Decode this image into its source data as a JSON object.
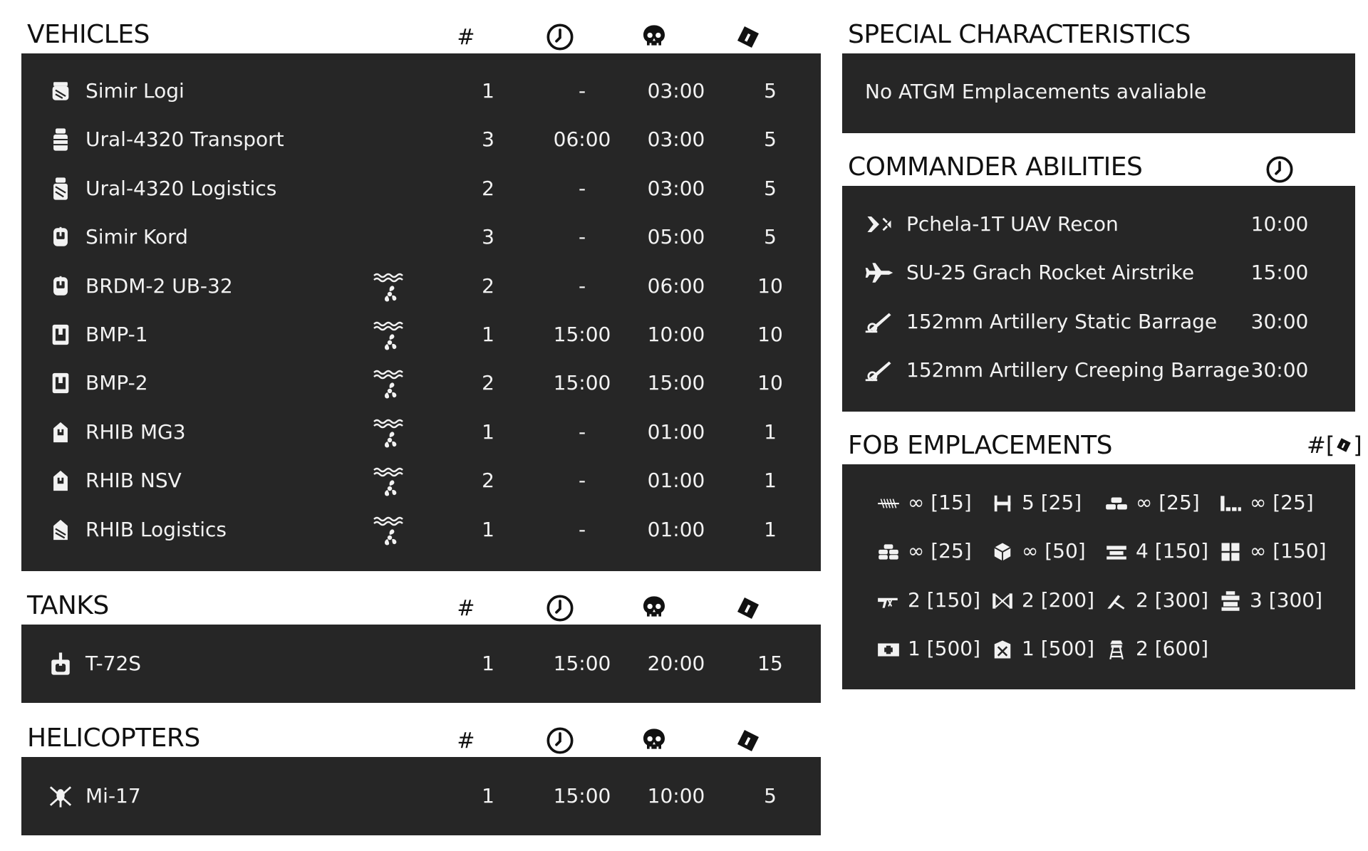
{
  "vehicles": {
    "title": "VEHICLES",
    "col_count": "#",
    "rows": [
      {
        "icon": "logistics-vehicle-icon",
        "name": "Simir Logi",
        "amphibious": false,
        "count": "1",
        "delay": "-",
        "respawn": "03:00",
        "tickets": "5"
      },
      {
        "icon": "transport-truck-icon",
        "name": "Ural-4320 Transport",
        "amphibious": false,
        "count": "3",
        "delay": "06:00",
        "respawn": "03:00",
        "tickets": "5"
      },
      {
        "icon": "logistics-truck-icon",
        "name": "Ural-4320 Logistics",
        "amphibious": false,
        "count": "2",
        "delay": "-",
        "respawn": "03:00",
        "tickets": "5"
      },
      {
        "icon": "armed-vehicle-icon",
        "name": "Simir Kord",
        "amphibious": false,
        "count": "3",
        "delay": "-",
        "respawn": "05:00",
        "tickets": "5"
      },
      {
        "icon": "armed-vehicle-icon",
        "name": "BRDM-2 UB-32",
        "amphibious": true,
        "count": "2",
        "delay": "-",
        "respawn": "06:00",
        "tickets": "10"
      },
      {
        "icon": "ifv-icon",
        "name": "BMP-1",
        "amphibious": true,
        "count": "1",
        "delay": "15:00",
        "respawn": "10:00",
        "tickets": "10"
      },
      {
        "icon": "ifv-icon",
        "name": "BMP-2",
        "amphibious": true,
        "count": "2",
        "delay": "15:00",
        "respawn": "15:00",
        "tickets": "10"
      },
      {
        "icon": "boat-icon",
        "name": "RHIB MG3",
        "amphibious": true,
        "count": "1",
        "delay": "-",
        "respawn": "01:00",
        "tickets": "1"
      },
      {
        "icon": "boat-icon",
        "name": "RHIB NSV",
        "amphibious": true,
        "count": "2",
        "delay": "-",
        "respawn": "01:00",
        "tickets": "1"
      },
      {
        "icon": "logistics-boat-icon",
        "name": "RHIB Logistics",
        "amphibious": true,
        "count": "1",
        "delay": "-",
        "respawn": "01:00",
        "tickets": "1"
      }
    ]
  },
  "tanks": {
    "title": "TANKS",
    "col_count": "#",
    "rows": [
      {
        "icon": "tank-icon",
        "name": "T-72S",
        "count": "1",
        "delay": "15:00",
        "respawn": "20:00",
        "tickets": "15"
      }
    ]
  },
  "helicopters": {
    "title": "HELICOPTERS",
    "col_count": "#",
    "rows": [
      {
        "icon": "helicopter-icon",
        "name": "Mi-17",
        "count": "1",
        "delay": "15:00",
        "respawn": "10:00",
        "tickets": "5"
      }
    ]
  },
  "special": {
    "title": "SPECIAL CHARACTERISTICS",
    "text": "No ATGM Emplacements avaliable"
  },
  "commander": {
    "title": "COMMANDER ABILITIES",
    "rows": [
      {
        "icon": "uav-icon",
        "name": "Pchela-1T UAV Recon",
        "time": "10:00"
      },
      {
        "icon": "jet-icon",
        "name": "SU-25 Grach Rocket Airstrike",
        "time": "15:00"
      },
      {
        "icon": "artillery-icon",
        "name": "152mm Artillery Static Barrage",
        "time": "30:00"
      },
      {
        "icon": "artillery-icon",
        "name": "152mm Artillery Creeping Barrage",
        "time": "30:00"
      }
    ]
  },
  "fob": {
    "title": "FOB EMPLACEMENTS",
    "header_label": "#[",
    "header_suffix": "]",
    "items": [
      {
        "icon": "razorwire-icon",
        "value": "∞ [15]"
      },
      {
        "icon": "hesco-icon",
        "value": "5 [25]"
      },
      {
        "icon": "sandbag-wall-icon",
        "value": "∞ [25]"
      },
      {
        "icon": "sandbag-corner-icon",
        "value": "∞ [25]"
      },
      {
        "icon": "sandbag-stack-icon",
        "value": "∞ [25]"
      },
      {
        "icon": "ammo-crate-icon",
        "value": "∞ [50]"
      },
      {
        "icon": "bunker-icon",
        "value": "4 [150]"
      },
      {
        "icon": "barrier-block-icon",
        "value": "∞ [150]"
      },
      {
        "icon": "machine-gun-icon",
        "value": "2 [150]"
      },
      {
        "icon": "tower-gate-icon",
        "value": "2 [200]"
      },
      {
        "icon": "mortar-icon",
        "value": "2 [300]"
      },
      {
        "icon": "bunker-stack-icon",
        "value": "3 [300]"
      },
      {
        "icon": "medical-crate-icon",
        "value": "1 [500]"
      },
      {
        "icon": "repair-station-icon",
        "value": "1 [500]"
      },
      {
        "icon": "watchtower-icon",
        "value": "2 [600]"
      }
    ]
  }
}
